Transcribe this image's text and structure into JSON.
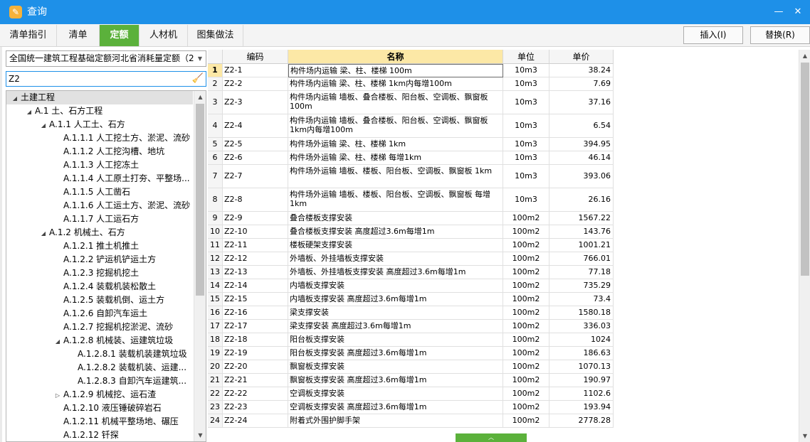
{
  "window": {
    "title": "查询",
    "min_glyph": "—",
    "close_glyph": "✕"
  },
  "tabs": [
    {
      "label": "清单指引",
      "active": false
    },
    {
      "label": "清单",
      "active": false
    },
    {
      "label": "定额",
      "active": true
    },
    {
      "label": "人材机",
      "active": false
    },
    {
      "label": "图集做法",
      "active": false
    }
  ],
  "toolbar": {
    "insert_label": "插入(I)",
    "replace_label": "替换(R)"
  },
  "quota_library": {
    "selected": "全国统一建筑工程基础定额河北省消耗量定额（2"
  },
  "search": {
    "value": "Z2"
  },
  "tree": [
    {
      "label": "土建工程",
      "level": 0,
      "toggle": "◢",
      "selected": true
    },
    {
      "label": "A.1 土、石方工程",
      "level": 1,
      "toggle": "◢"
    },
    {
      "label": "A.1.1 人工土、石方",
      "level": 2,
      "toggle": "◢"
    },
    {
      "label": "A.1.1.1 人工挖土方、淤泥、流砂",
      "level": 3,
      "toggle": ""
    },
    {
      "label": "A.1.1.2 人工挖沟槽、地坑",
      "level": 3,
      "toggle": ""
    },
    {
      "label": "A.1.1.3 人工挖冻土",
      "level": 3,
      "toggle": ""
    },
    {
      "label": "A.1.1.4 人工原土打夯、平整场...",
      "level": 3,
      "toggle": ""
    },
    {
      "label": "A.1.1.5 人工凿石",
      "level": 3,
      "toggle": ""
    },
    {
      "label": "A.1.1.6 人工运土方、淤泥、流砂",
      "level": 3,
      "toggle": ""
    },
    {
      "label": "A.1.1.7 人工运石方",
      "level": 3,
      "toggle": ""
    },
    {
      "label": "A.1.2 机械土、石方",
      "level": 2,
      "toggle": "◢"
    },
    {
      "label": "A.1.2.1 推土机推土",
      "level": 3,
      "toggle": ""
    },
    {
      "label": "A.1.2.2 铲运机铲运土方",
      "level": 3,
      "toggle": ""
    },
    {
      "label": "A.1.2.3 挖掘机挖土",
      "level": 3,
      "toggle": ""
    },
    {
      "label": "A.1.2.4 装载机装松散土",
      "level": 3,
      "toggle": ""
    },
    {
      "label": "A.1.2.5 装载机倒、运土方",
      "level": 3,
      "toggle": ""
    },
    {
      "label": "A.1.2.6 自卸汽车运土",
      "level": 3,
      "toggle": ""
    },
    {
      "label": "A.1.2.7 挖掘机挖淤泥、流砂",
      "level": 3,
      "toggle": ""
    },
    {
      "label": "A.1.2.8 机械装、运建筑垃圾",
      "level": 3,
      "toggle": "◢"
    },
    {
      "label": "A.1.2.8.1 装载机装建筑垃圾",
      "level": 4,
      "toggle": ""
    },
    {
      "label": "A.1.2.8.2 装载机装、运建...",
      "level": 4,
      "toggle": ""
    },
    {
      "label": "A.1.2.8.3 自卸汽车运建筑...",
      "level": 4,
      "toggle": ""
    },
    {
      "label": "A.1.2.9 机械挖、运石渣",
      "level": 3,
      "toggle": "▷"
    },
    {
      "label": "A.1.2.10 液压锤破碎岩石",
      "level": 3,
      "toggle": ""
    },
    {
      "label": "A.1.2.11 机械平整场地、碾压",
      "level": 3,
      "toggle": ""
    },
    {
      "label": "A.1.2.12 钎探",
      "level": 3,
      "toggle": ""
    }
  ],
  "grid": {
    "columns": {
      "code": "编码",
      "name": "名称",
      "unit": "单位",
      "price": "单价"
    },
    "rows": [
      {
        "no": "1",
        "code": "Z2-1",
        "name": "构件场内运输 梁、柱、楼梯 100m",
        "unit": "10m3",
        "price": "38.24"
      },
      {
        "no": "2",
        "code": "Z2-2",
        "name": "构件场内运输 梁、柱、楼梯 1km内每增100m",
        "unit": "10m3",
        "price": "7.69"
      },
      {
        "no": "3",
        "code": "Z2-3",
        "name": "构件场内运输 墙板、叠合楼板、阳台板、空调板、飘窗板 100m",
        "unit": "10m3",
        "price": "37.16"
      },
      {
        "no": "4",
        "code": "Z2-4",
        "name": "构件场内运输 墙板、叠合楼板、阳台板、空调板、飘窗板 1km内每增100m",
        "unit": "10m3",
        "price": "6.54"
      },
      {
        "no": "5",
        "code": "Z2-5",
        "name": "构件场外运输 梁、柱、楼梯 1km",
        "unit": "10m3",
        "price": "394.95"
      },
      {
        "no": "6",
        "code": "Z2-6",
        "name": "构件场外运输 梁、柱、楼梯 每增1km",
        "unit": "10m3",
        "price": "46.14"
      },
      {
        "no": "7",
        "code": "Z2-7",
        "name": "构件场外运输 墙板、楼板、阳台板、空调板、飘窗板 1km",
        "unit": "10m3",
        "price": "393.06"
      },
      {
        "no": "8",
        "code": "Z2-8",
        "name": "构件场外运输 墙板、楼板、阳台板、空调板、飘窗板 每增1km",
        "unit": "10m3",
        "price": "26.16"
      },
      {
        "no": "9",
        "code": "Z2-9",
        "name": "叠合楼板支撑安装",
        "unit": "100m2",
        "price": "1567.22"
      },
      {
        "no": "10",
        "code": "Z2-10",
        "name": "叠合楼板支撑安装 高度超过3.6m每增1m",
        "unit": "100m2",
        "price": "143.76"
      },
      {
        "no": "11",
        "code": "Z2-11",
        "name": "楼板硬架支撑安装",
        "unit": "100m2",
        "price": "1001.21"
      },
      {
        "no": "12",
        "code": "Z2-12",
        "name": "外墙板、外挂墙板支撑安装",
        "unit": "100m2",
        "price": "766.01"
      },
      {
        "no": "13",
        "code": "Z2-13",
        "name": "外墙板、外挂墙板支撑安装 高度超过3.6m每增1m",
        "unit": "100m2",
        "price": "77.18"
      },
      {
        "no": "14",
        "code": "Z2-14",
        "name": "内墙板支撑安装",
        "unit": "100m2",
        "price": "735.29"
      },
      {
        "no": "15",
        "code": "Z2-15",
        "name": "内墙板支撑安装 高度超过3.6m每增1m",
        "unit": "100m2",
        "price": "73.4"
      },
      {
        "no": "16",
        "code": "Z2-16",
        "name": "梁支撑安装",
        "unit": "100m2",
        "price": "1580.18"
      },
      {
        "no": "17",
        "code": "Z2-17",
        "name": "梁支撑安装 高度超过3.6m每增1m",
        "unit": "100m2",
        "price": "336.03"
      },
      {
        "no": "18",
        "code": "Z2-18",
        "name": "阳台板支撑安装",
        "unit": "100m2",
        "price": "1024"
      },
      {
        "no": "19",
        "code": "Z2-19",
        "name": "阳台板支撑安装 高度超过3.6m每增1m",
        "unit": "100m2",
        "price": "186.63"
      },
      {
        "no": "20",
        "code": "Z2-20",
        "name": "飘窗板支撑安装",
        "unit": "100m2",
        "price": "1070.13"
      },
      {
        "no": "21",
        "code": "Z2-21",
        "name": "飘窗板支撑安装 高度超过3.6m每增1m",
        "unit": "100m2",
        "price": "190.97"
      },
      {
        "no": "22",
        "code": "Z2-22",
        "name": "空调板支撑安装",
        "unit": "100m2",
        "price": "1102.6"
      },
      {
        "no": "23",
        "code": "Z2-23",
        "name": "空调板支撑安装 高度超过3.6m每增1m",
        "unit": "100m2",
        "price": "193.94"
      },
      {
        "no": "24",
        "code": "Z2-24",
        "name": "附着式外围护脚手架",
        "unit": "100m2",
        "price": "2778.28"
      }
    ]
  }
}
